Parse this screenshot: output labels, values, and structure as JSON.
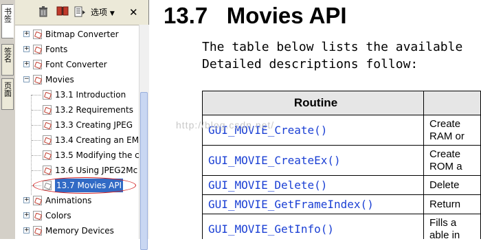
{
  "sidetabs": [
    "书签",
    "签名",
    "页面"
  ],
  "toolbar": {
    "options_label": "选项"
  },
  "tree": [
    {
      "label": "Bitmap Converter",
      "level": 0,
      "expander": "+"
    },
    {
      "label": "Fonts",
      "level": 0,
      "expander": "+"
    },
    {
      "label": "Font Converter",
      "level": 0,
      "expander": "+"
    },
    {
      "label": "Movies",
      "level": 0,
      "expander": "−"
    },
    {
      "label": "13.1 Introduction",
      "level": 1
    },
    {
      "label": "13.2 Requirements",
      "level": 1
    },
    {
      "label": "13.3 Creating JPEG",
      "level": 1
    },
    {
      "label": "13.4 Creating an EM",
      "level": 1
    },
    {
      "label": "13.5 Modifying the c",
      "level": 1
    },
    {
      "label": "13.6 Using JPEG2Mc",
      "level": 1
    },
    {
      "label": "13.7 Movies API",
      "level": 1,
      "selected": true
    },
    {
      "label": "Animations",
      "level": 0,
      "expander": "+"
    },
    {
      "label": "Colors",
      "level": 0,
      "expander": "+"
    },
    {
      "label": "Memory Devices",
      "level": 0,
      "expander": "+"
    }
  ],
  "document": {
    "heading_number": "13.7",
    "heading_text": "Movies API",
    "intro_line1": "The table below lists the available",
    "intro_line2": "Detailed descriptions follow:",
    "table": {
      "header": "Routine",
      "rows": [
        {
          "routine": "GUI_MOVIE_Create()",
          "desc": [
            "Create",
            "RAM or"
          ]
        },
        {
          "routine": "GUI_MOVIE_CreateEx()",
          "desc": [
            "Create",
            "ROM a"
          ]
        },
        {
          "routine": "GUI_MOVIE_Delete()",
          "desc": [
            "Delete"
          ]
        },
        {
          "routine": "GUI_MOVIE_GetFrameIndex()",
          "desc": [
            "Return"
          ]
        },
        {
          "routine": "GUI_MOVIE_GetInfo()",
          "desc": [
            "Fills a",
            "able in"
          ]
        }
      ]
    },
    "watermark": "http://blog.csdn.net/"
  }
}
